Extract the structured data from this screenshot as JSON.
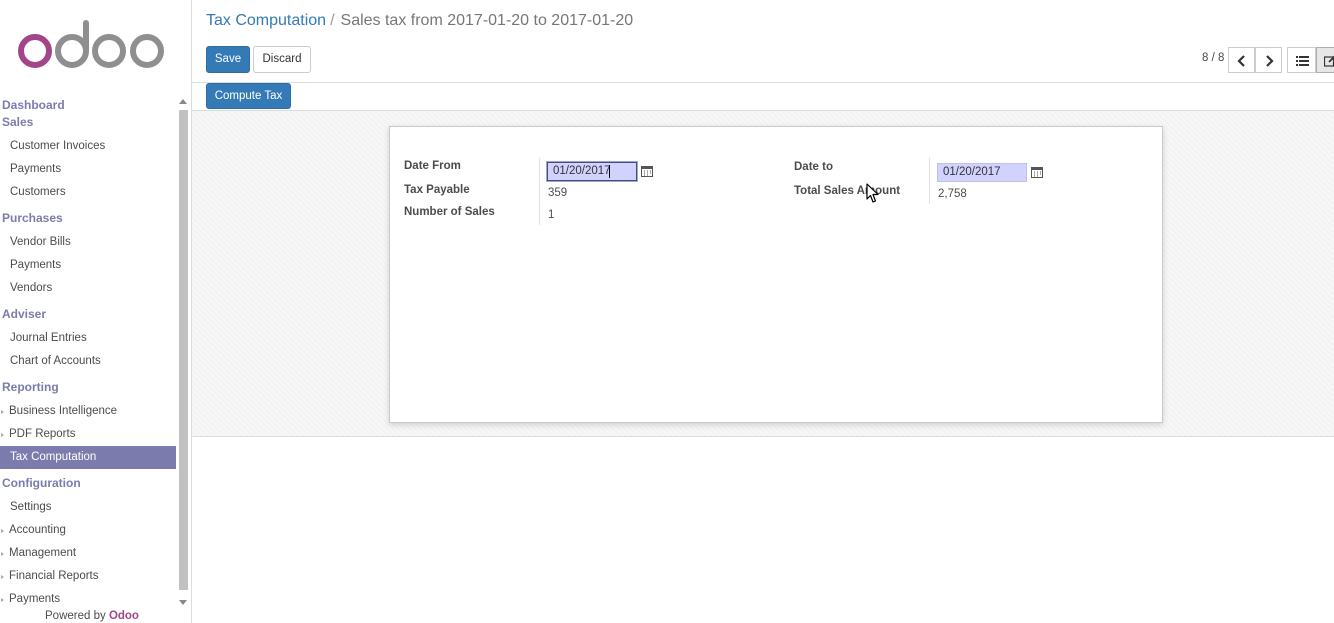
{
  "sidebar": {
    "logo_text": "odoo",
    "menu": [
      {
        "type": "section",
        "label": "Dashboard"
      },
      {
        "type": "section",
        "label": "Sales"
      },
      {
        "type": "item",
        "label": "Customer Invoices"
      },
      {
        "type": "item",
        "label": "Payments"
      },
      {
        "type": "item",
        "label": "Customers"
      },
      {
        "type": "section",
        "label": "Purchases"
      },
      {
        "type": "item",
        "label": "Vendor Bills"
      },
      {
        "type": "item",
        "label": "Payments"
      },
      {
        "type": "item",
        "label": "Vendors"
      },
      {
        "type": "section",
        "label": "Adviser"
      },
      {
        "type": "item",
        "label": "Journal Entries"
      },
      {
        "type": "item",
        "label": "Chart of Accounts"
      },
      {
        "type": "section",
        "label": "Reporting"
      },
      {
        "type": "item",
        "label": "Business Intelligence",
        "submenu": true
      },
      {
        "type": "item",
        "label": "PDF Reports",
        "submenu": true
      },
      {
        "type": "item",
        "label": "Tax Computation",
        "active": true
      },
      {
        "type": "section",
        "label": "Configuration"
      },
      {
        "type": "item",
        "label": "Settings"
      },
      {
        "type": "item",
        "label": "Accounting",
        "submenu": true
      },
      {
        "type": "item",
        "label": "Management",
        "submenu": true
      },
      {
        "type": "item",
        "label": "Financial Reports",
        "submenu": true
      },
      {
        "type": "item",
        "label": "Payments",
        "submenu": true
      }
    ],
    "powered_by": "Powered by",
    "powered_brand": "Odoo"
  },
  "breadcrumb": {
    "parent": "Tax Computation",
    "separator": "/",
    "current": "Sales tax from 2017-01-20 to 2017-01-20"
  },
  "buttons": {
    "save": "Save",
    "discard": "Discard",
    "compute_tax": "Compute Tax"
  },
  "pager": {
    "value": "8 / 8"
  },
  "form": {
    "date_from_label": "Date From",
    "date_from_value": "01/20/2017",
    "tax_payable_label": "Tax Payable",
    "tax_payable_value": "359",
    "number_of_sales_label": "Number of Sales",
    "number_of_sales_value": "1",
    "date_to_label": "Date to",
    "date_to_value": "01/20/2017",
    "total_sales_label": "Total Sales Amount",
    "total_sales_value": "2,758"
  },
  "colors": {
    "brand_purple": "#7c7bad",
    "primary_blue": "#337ab7",
    "date_field_bg": "#d2d2ff"
  }
}
